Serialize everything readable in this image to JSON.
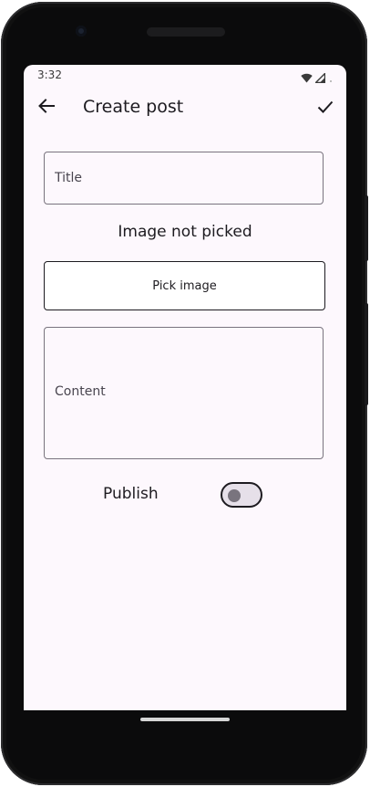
{
  "status_bar": {
    "time": "3:32"
  },
  "app_bar": {
    "title": "Create post"
  },
  "form": {
    "title_placeholder": "Title",
    "title_value": "",
    "image_status": "Image not picked",
    "pick_image_label": "Pick image",
    "content_placeholder": "Content",
    "content_value": "",
    "publish_label": "Publish",
    "publish_enabled": false
  },
  "icons": {
    "back": "arrow-back-icon",
    "confirm": "check-icon",
    "wifi": "wifi-icon",
    "signal": "cell-signal-icon",
    "battery": "battery-icon"
  },
  "colors": {
    "screen_background": "#fdf8fd",
    "text": "#1d1b20",
    "outline": "#79747e",
    "switch_track": "#e6e0e9"
  }
}
